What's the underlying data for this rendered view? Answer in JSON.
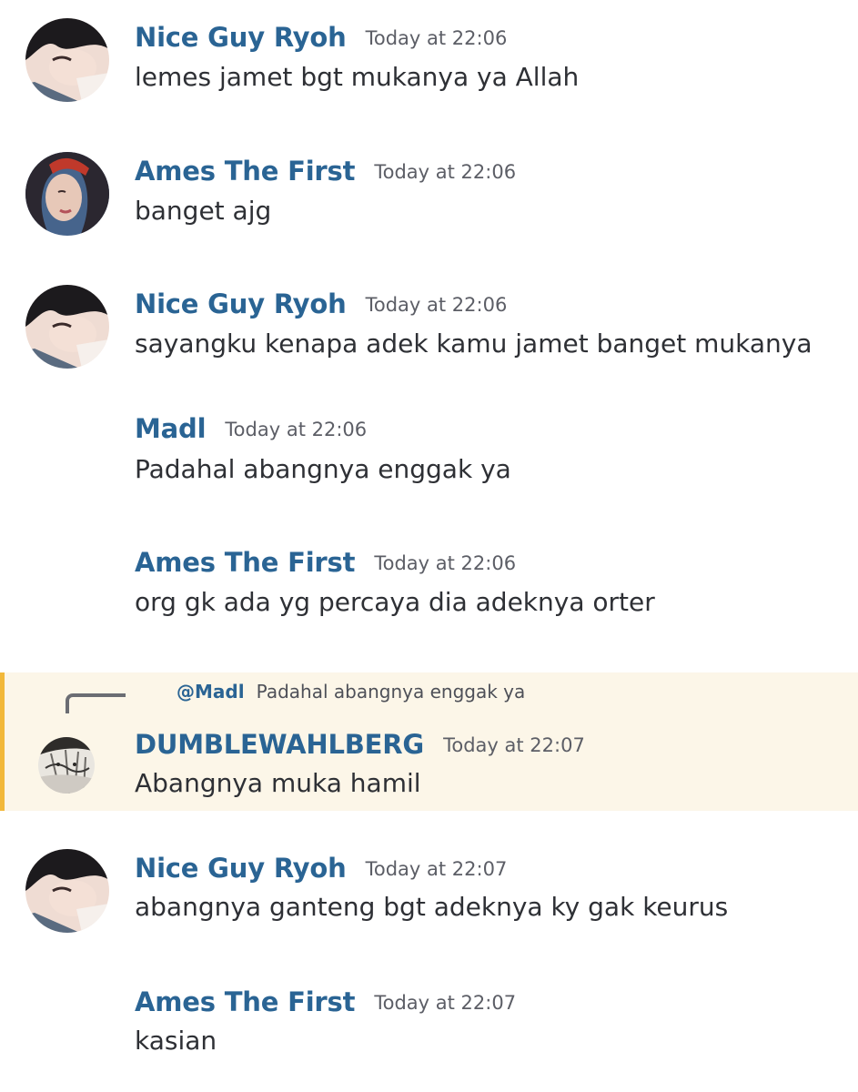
{
  "messages": [
    {
      "author": "Nice Guy Ryoh",
      "timestamp": "Today at 22:06",
      "text": "lemes jamet bgt mukanya ya Allah"
    },
    {
      "author": "Ames The First",
      "timestamp": "Today at 22:06",
      "text": "banget ajg"
    },
    {
      "author": "Nice Guy Ryoh",
      "timestamp": "Today at 22:06",
      "text": "sayangku kenapa adek kamu jamet banget mukanya"
    },
    {
      "author": "Madl",
      "timestamp": "Today at 22:06",
      "text": "Padahal abangnya enggak ya"
    },
    {
      "author": "Ames The First",
      "timestamp": "Today at 22:06",
      "text": "org gk ada yg percaya dia adeknya orter"
    },
    {
      "author": "DUMBLEWAHLBERG",
      "timestamp": "Today at 22:07",
      "text": "Abangnya muka hamil",
      "reply": {
        "mention": "@Madl",
        "text": "Padahal abangnya enggak ya"
      }
    },
    {
      "author": "Nice Guy Ryoh",
      "timestamp": "Today at 22:07",
      "text": "abangnya ganteng bgt adeknya ky gak keurus"
    },
    {
      "author": "Ames The First",
      "timestamp": "Today at 22:07",
      "text": "kasian"
    }
  ],
  "colors": {
    "author": "#2a6494",
    "timestamp": "#5c5e66",
    "text": "#2e3035",
    "highlight_bg": "#fcf6e8",
    "highlight_border": "#f2b83a"
  },
  "icons": {
    "ryoh_avatar": "avatar-ryoh-icon",
    "ames_avatar": "avatar-ames-icon",
    "dumble_avatar": "avatar-dumble-icon"
  }
}
